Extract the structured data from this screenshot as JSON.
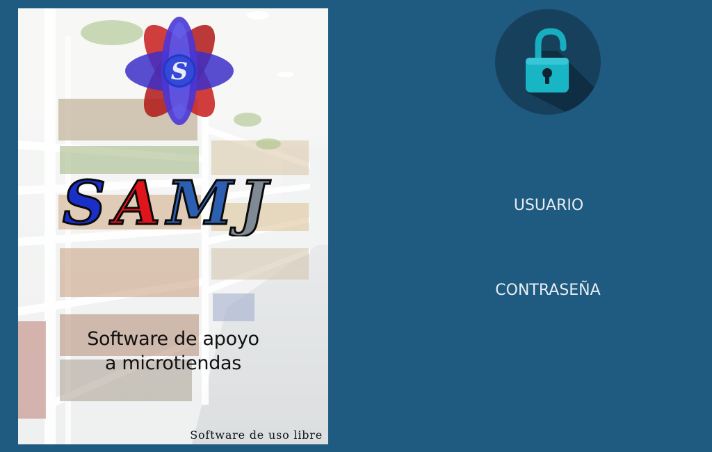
{
  "poster": {
    "brand": "SAMJ",
    "brand_letters": [
      {
        "char": "S",
        "color": "#1a2fc8"
      },
      {
        "char": "A",
        "color": "#e0141b"
      },
      {
        "char": "M",
        "color": "#2d5fb0"
      },
      {
        "char": "J",
        "color": "#7f8a94"
      }
    ],
    "logo_letter": "S",
    "tagline_line1": "Software de apoyo",
    "tagline_line2": "a microtiendas",
    "footer": "Software de uso libre"
  },
  "login": {
    "lock_icon": "unlocked-padlock-icon",
    "user_label": "USUARIO",
    "password_label": "CONTRASEÑA"
  },
  "colors": {
    "background": "#1f5a80",
    "lock_circle": "#17405c",
    "lock_body": "#18b5c5",
    "label_text": "#e6edf2"
  }
}
